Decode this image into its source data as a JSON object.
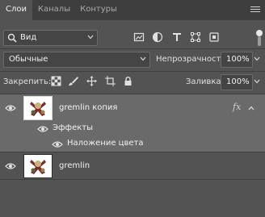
{
  "tabs": [
    {
      "label": "Слои",
      "active": true
    },
    {
      "label": "Каналы",
      "active": false
    },
    {
      "label": "Контуры",
      "active": false
    }
  ],
  "filter": {
    "kind_value": "Вид",
    "icons": [
      "image-filter-icon",
      "adjustment-filter-icon",
      "type-filter-icon",
      "shape-filter-icon",
      "smart-object-filter-icon"
    ]
  },
  "blend": {
    "mode_value": "Обычные",
    "opacity_label": "Непрозрачность:",
    "opacity_value": "100%"
  },
  "locks": {
    "label": "Закрепить:",
    "icons": [
      "lock-transparent-pixels-icon",
      "lock-image-pixels-icon",
      "lock-position-icon",
      "lock-artboard-icon",
      "lock-all-icon"
    ],
    "fill_label": "Заливка:",
    "fill_value": "100%"
  },
  "layers": [
    {
      "name": "gremlin копия",
      "selected": true,
      "fx_label": "fx",
      "effects_label": "Эффекты",
      "effects": [
        "Наложение цвета"
      ]
    },
    {
      "name": "gremlin",
      "selected": false
    }
  ],
  "colors": {
    "panel_bg": "#535353",
    "tabbar_bg": "#3e3e3e",
    "selected_row": "#6a6a6a",
    "field_bg": "#454545"
  }
}
